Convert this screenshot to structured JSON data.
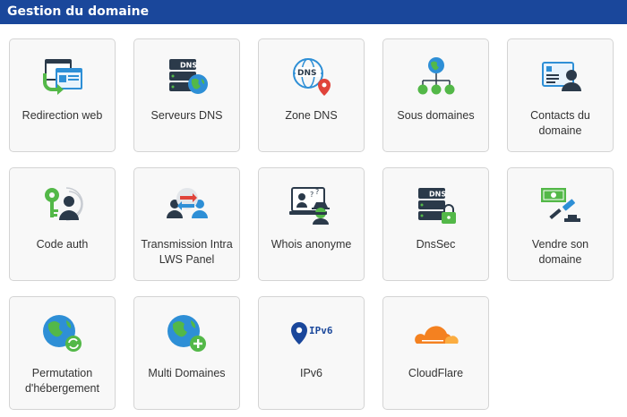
{
  "header": {
    "title": "Gestion du domaine"
  },
  "tiles": [
    {
      "label": "Redirection web",
      "icon": "redirect-icon"
    },
    {
      "label": "Serveurs DNS",
      "icon": "dns-server-icon"
    },
    {
      "label": "Zone DNS",
      "icon": "dns-zone-icon"
    },
    {
      "label": "Sous domaines",
      "icon": "subdomains-icon"
    },
    {
      "label": "Contacts du domaine",
      "icon": "contact-card-icon"
    },
    {
      "label": "Code auth",
      "icon": "key-user-icon"
    },
    {
      "label": "Transmission Intra LWS Panel",
      "icon": "transfer-users-icon"
    },
    {
      "label": "Whois anonyme",
      "icon": "anonymous-user-icon"
    },
    {
      "label": "DnsSec",
      "icon": "dns-lock-icon"
    },
    {
      "label": "Vendre son domaine",
      "icon": "auction-money-icon"
    },
    {
      "label": "Permutation d'hébergement",
      "icon": "globe-refresh-icon"
    },
    {
      "label": "Multi Domaines",
      "icon": "globe-plus-icon"
    },
    {
      "label": "IPv6",
      "icon": "ipv6-pin-icon",
      "icon_text": "IPv6"
    },
    {
      "label": "CloudFlare",
      "icon": "cloudflare-icon"
    }
  ],
  "icon_badge_text": "DNS",
  "colors": {
    "header_bg": "#1a479b",
    "globe_blue": "#2e8fd6",
    "globe_green": "#53b848",
    "dark": "#2b3a4a",
    "cloud_orange": "#f48120",
    "pin_red": "#e0433a"
  }
}
